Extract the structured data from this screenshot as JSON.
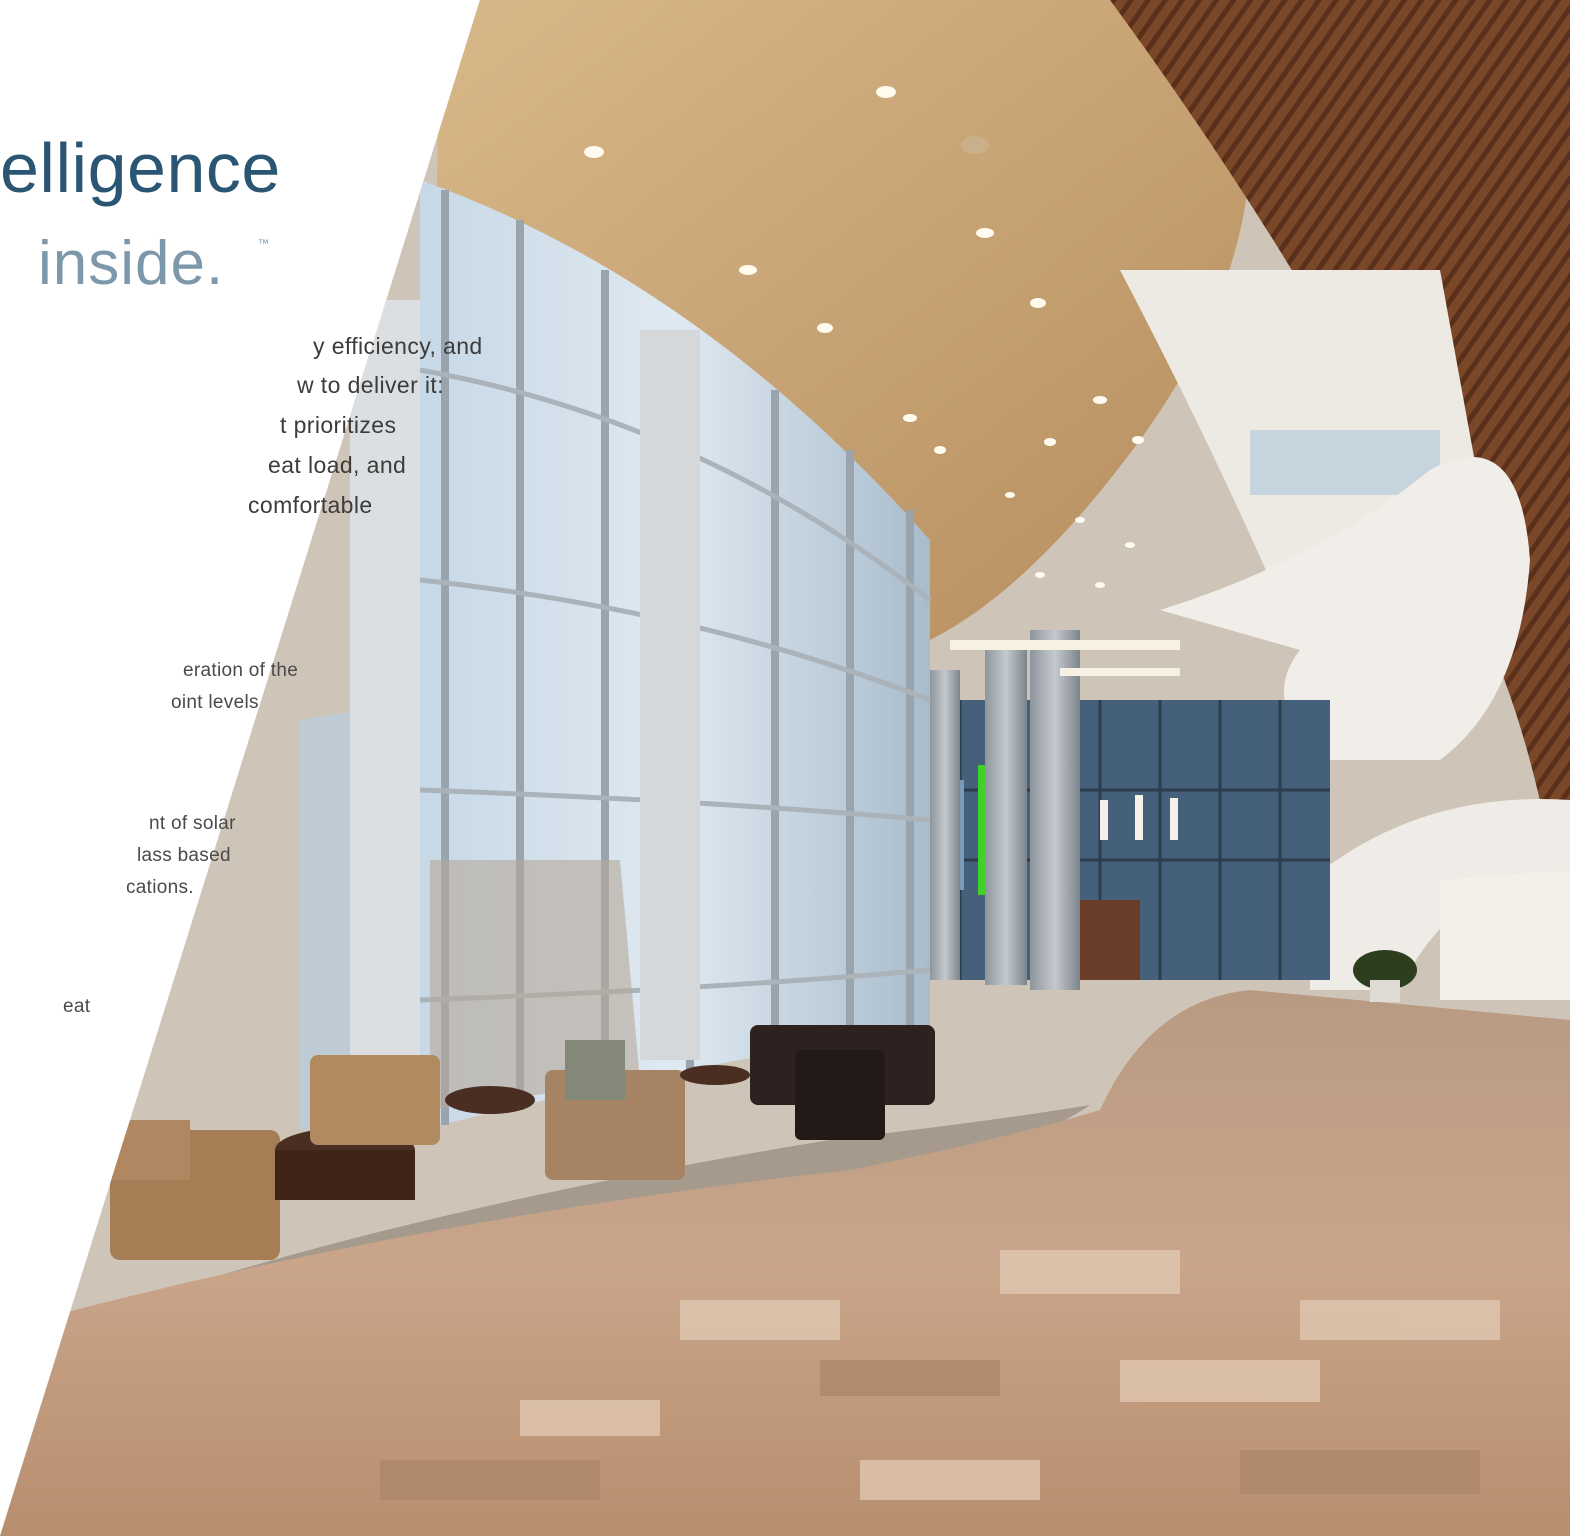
{
  "headline": {
    "line1": "elligence",
    "line2": "inside.",
    "trademark": "™"
  },
  "intro_lines": [
    "y efficiency, and",
    "w to deliver it:",
    "t prioritizes",
    "eat load, and",
    "comfortable"
  ],
  "feature_1": [
    "eration of the",
    "oint levels"
  ],
  "feature_2": [
    "nt of solar",
    "lass based",
    "cations."
  ],
  "feature_3": [
    "eat"
  ],
  "colors": {
    "headline_dark": "#2a5674",
    "headline_light": "#7d97ab",
    "body_text": "#3c3c3c",
    "background": "#ffffff"
  }
}
